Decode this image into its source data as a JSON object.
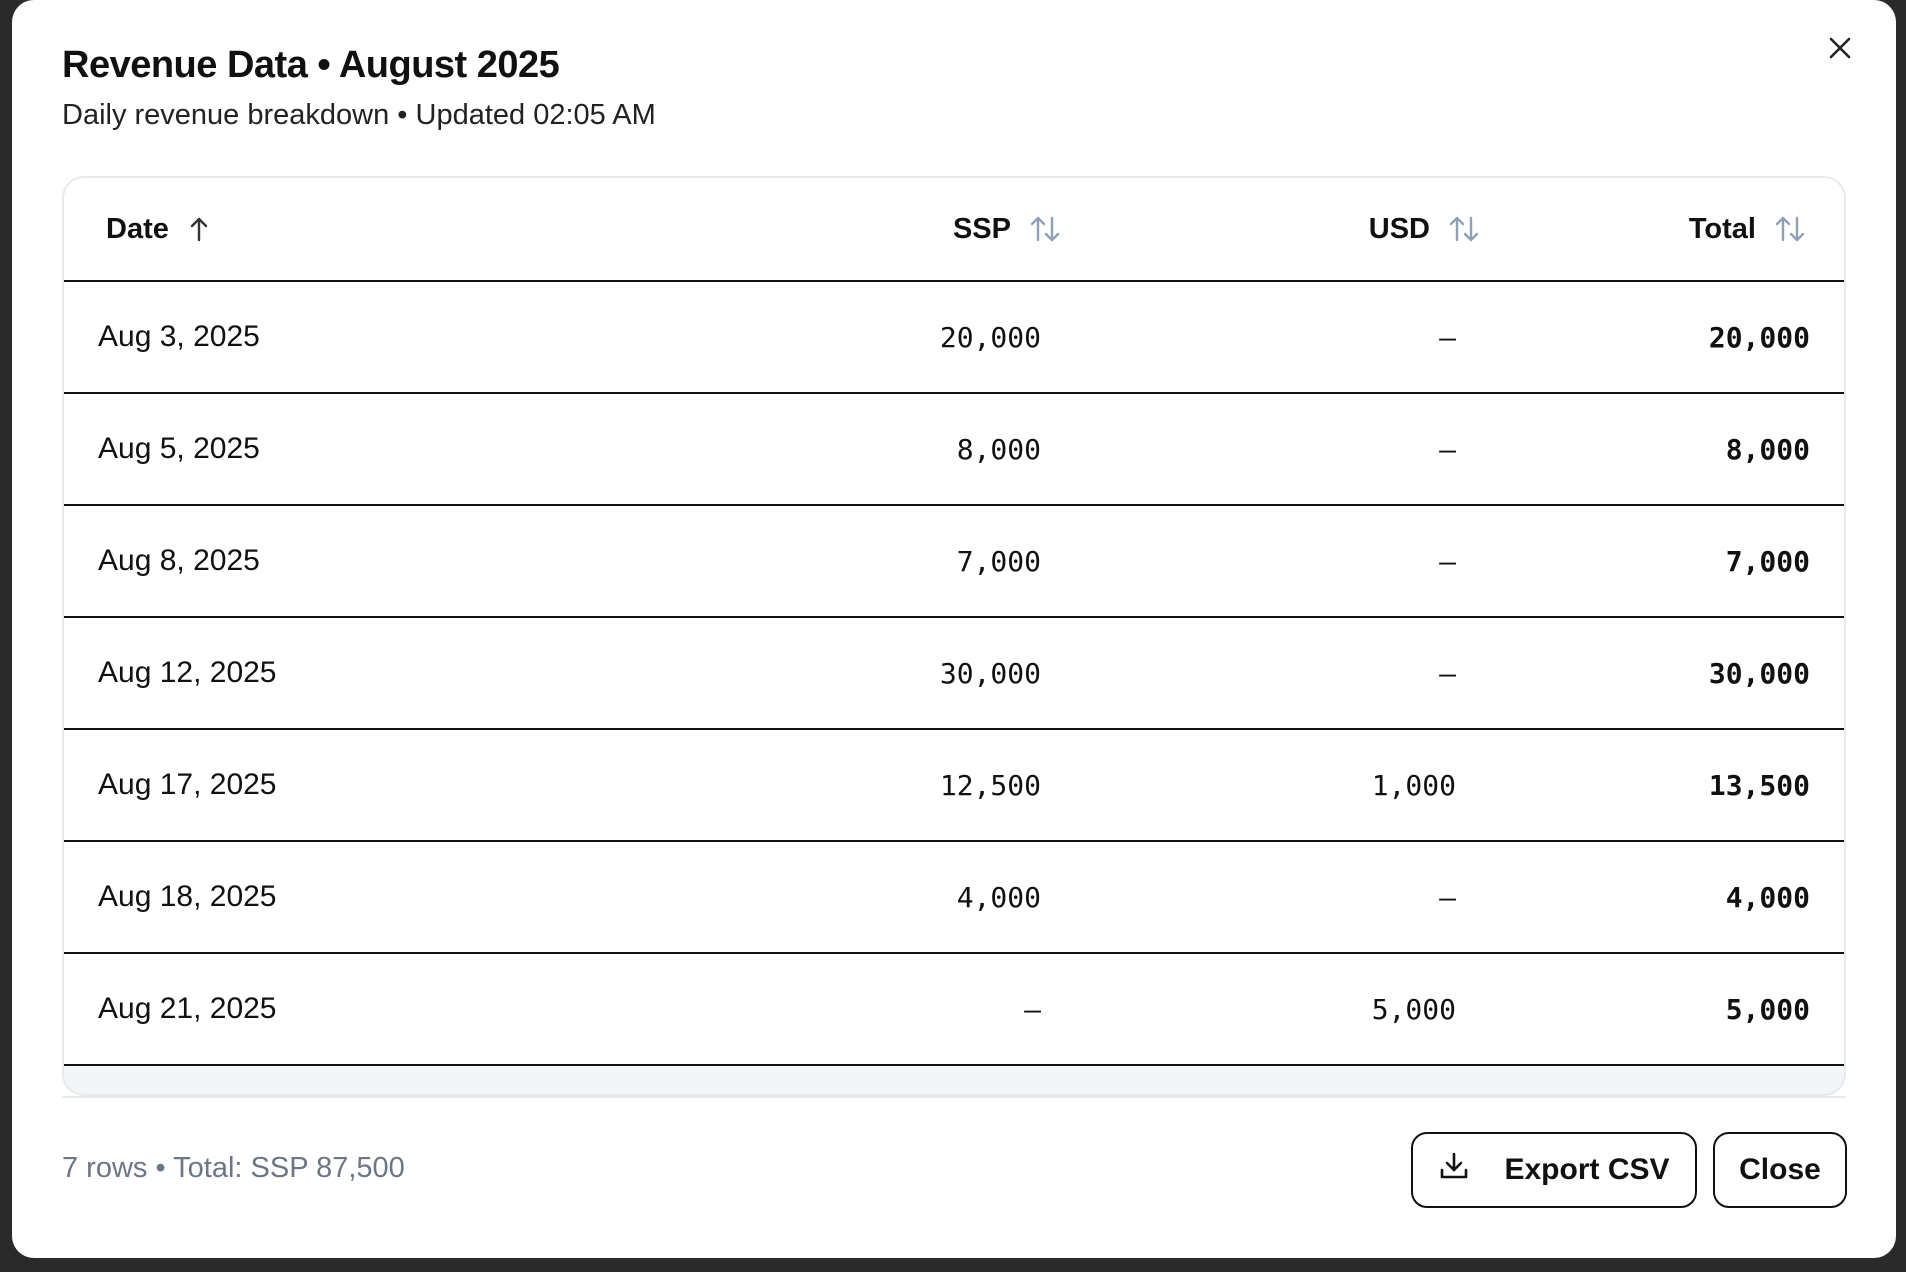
{
  "dialog": {
    "title": "Revenue Data • August 2025",
    "subtitle": "Daily revenue breakdown • Updated 02:05 AM"
  },
  "table": {
    "columns": [
      {
        "label": "Date",
        "sort": "ascending"
      },
      {
        "label": "SSP",
        "sort": "none"
      },
      {
        "label": "USD",
        "sort": "none"
      },
      {
        "label": "Total",
        "sort": "none"
      }
    ],
    "rows": [
      {
        "date": "Aug 3, 2025",
        "ssp": "20,000",
        "usd": "—",
        "total": "20,000"
      },
      {
        "date": "Aug 5, 2025",
        "ssp": "8,000",
        "usd": "—",
        "total": "8,000"
      },
      {
        "date": "Aug 8, 2025",
        "ssp": "7,000",
        "usd": "—",
        "total": "7,000"
      },
      {
        "date": "Aug 12, 2025",
        "ssp": "30,000",
        "usd": "—",
        "total": "30,000"
      },
      {
        "date": "Aug 17, 2025",
        "ssp": "12,500",
        "usd": "1,000",
        "total": "13,500"
      },
      {
        "date": "Aug 18, 2025",
        "ssp": "4,000",
        "usd": "—",
        "total": "4,000"
      },
      {
        "date": "Aug 21, 2025",
        "ssp": "—",
        "usd": "5,000",
        "total": "5,000"
      }
    ]
  },
  "footer": {
    "summary": "7 rows • Total: SSP 87,500",
    "export_label": "Export CSV",
    "close_label": "Close"
  },
  "icons": {
    "close": "close-icon",
    "sort_asc": "arrow-up-icon",
    "sort_both": "sort-icon",
    "download": "download-icon"
  },
  "colors": {
    "text": "#111111",
    "muted": "#6b7686",
    "sort_inactive": "#8fa0b8",
    "border": "#e6e9ee"
  }
}
